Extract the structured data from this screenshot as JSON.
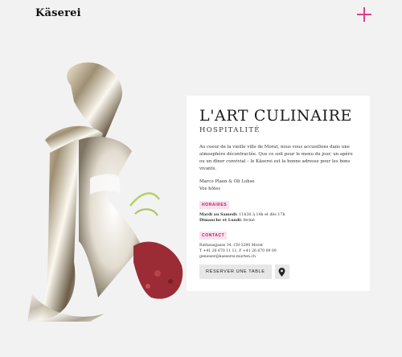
{
  "header": {
    "logo_text": "Käserei",
    "menu_icon": "plus-icon"
  },
  "colors": {
    "accent": "#e0418a",
    "tag_bg": "#f7e3ee",
    "tag_text": "#c2185b",
    "background": "#f2f2f2",
    "card": "#ffffff"
  },
  "hero": {
    "decoration": "blackletter-K-photo-mask"
  },
  "card": {
    "title": "L'ART CULINAIRE",
    "subtitle": "HOSPITALITÉ",
    "intro": "Au coeur de la vieille ville de Morat, nous vous accueillons dans une atmosphère décontractée. Que ce soit pour le menu du jour, un apéro ou un dîner convivial – le Käserei est la bonne adresse pour les bons vivants.",
    "names": "Marco Plaen & Oli Lohse",
    "role": "Vos hôtes",
    "hours_label": "HORAIRES",
    "hours": [
      {
        "day": "Mardi au Samedi:",
        "time": "11h30 à 14h et dès 17h"
      },
      {
        "day": "Dimanche et Lundi:",
        "time": "fermé"
      }
    ],
    "contact_label": "CONTACT",
    "address": "Rathausgasse 34, CH-3280 Morat",
    "phone": "T +41 26 670 11 11, F +41 26 670 09 09",
    "email": "genieser@kaeserei-murten.ch",
    "reserve_label": "RÉSERVER UNE TABLE",
    "map_icon": "map-pin-icon"
  }
}
